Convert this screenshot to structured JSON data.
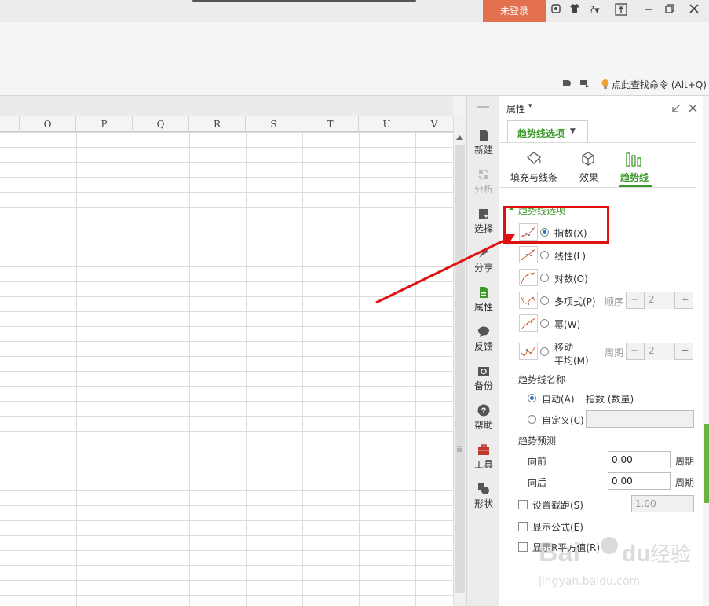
{
  "titlebar": {
    "login_label": "未登录",
    "icons": [
      "skin-icon",
      "shirt-icon",
      "help-icon",
      "upload-icon",
      "minimize-icon",
      "restore-icon",
      "close-icon"
    ]
  },
  "ribbon": {
    "command_search": "点此查找命令 (Alt+Q)"
  },
  "grid": {
    "columns": [
      "O",
      "P",
      "Q",
      "R",
      "S",
      "T",
      "U",
      "V"
    ]
  },
  "sidebar": {
    "items": [
      {
        "label": "新建",
        "icon": "new-doc-icon",
        "enabled": true
      },
      {
        "label": "分析",
        "icon": "analysis-icon",
        "enabled": false
      },
      {
        "label": "选择",
        "icon": "select-icon",
        "enabled": true
      },
      {
        "label": "分享",
        "icon": "share-icon",
        "enabled": true
      },
      {
        "label": "属性",
        "icon": "property-icon",
        "enabled": true,
        "active": true
      },
      {
        "label": "反馈",
        "icon": "feedback-icon",
        "enabled": true
      },
      {
        "label": "备份",
        "icon": "backup-icon",
        "enabled": true
      },
      {
        "label": "帮助",
        "icon": "help-circle-icon",
        "enabled": true
      },
      {
        "label": "工具",
        "icon": "toolbox-icon",
        "enabled": true
      },
      {
        "label": "形状",
        "icon": "shape-icon",
        "enabled": true
      }
    ]
  },
  "panel": {
    "title": "属性",
    "dropdown": "趋势线选项",
    "tabs": [
      {
        "label": "填充与线条",
        "icon": "fill-bucket-icon"
      },
      {
        "label": "效果",
        "icon": "cube-icon"
      },
      {
        "label": "趋势线",
        "icon": "bar-chart-icon",
        "active": true
      }
    ],
    "section_title": "趋势线选项",
    "trend_types": [
      {
        "label": "指数(X)",
        "selected": true
      },
      {
        "label": "线性(L)",
        "selected": false
      },
      {
        "label": "对数(O)",
        "selected": false
      },
      {
        "label": "多项式(P)",
        "selected": false
      },
      {
        "label": "幂(W)",
        "selected": false
      },
      {
        "label": "移动",
        "label2": "平均(M)",
        "selected": false
      }
    ],
    "order_label": "顺序",
    "order_value": "2",
    "period_label": "周期",
    "period_value": "2",
    "name_title": "趋势线名称",
    "auto_label": "自动(A)",
    "auto_value": "指数 (数量)",
    "custom_label": "自定义(C)",
    "forecast_title": "趋势预测",
    "forward_label": "向前",
    "forward_value": "0.00",
    "forward_unit": "周期",
    "backward_label": "向后",
    "backward_value": "0.00",
    "backward_unit": "周期",
    "intercept_label": "设置截距(S)",
    "intercept_value": "1.00",
    "show_formula_label": "显示公式(E)",
    "show_r2_label": "显示R平方值(R)"
  },
  "watermark": {
    "brand": "Bai",
    "brand2": "du",
    "brand_cn": "经验",
    "url": "jingyan.baidu.com"
  },
  "colors": {
    "accent_green": "#3d9a2a",
    "login_orange": "#e4704f",
    "highlight_red": "#e01010"
  }
}
